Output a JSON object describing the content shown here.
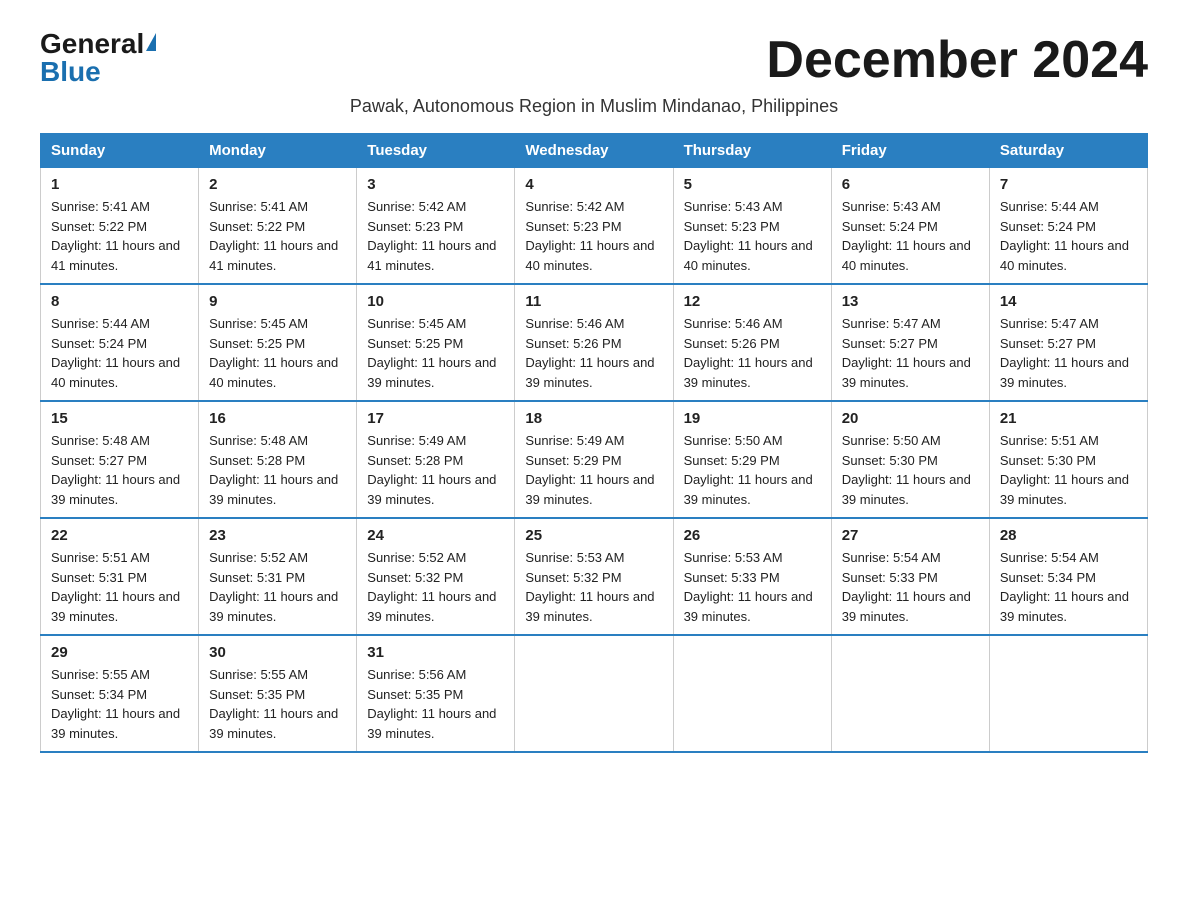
{
  "logo": {
    "general": "General",
    "blue": "Blue"
  },
  "title": "December 2024",
  "subtitle": "Pawak, Autonomous Region in Muslim Mindanao, Philippines",
  "days_of_week": [
    "Sunday",
    "Monday",
    "Tuesday",
    "Wednesday",
    "Thursday",
    "Friday",
    "Saturday"
  ],
  "weeks": [
    [
      {
        "day": "1",
        "sunrise": "5:41 AM",
        "sunset": "5:22 PM",
        "daylight": "11 hours and 41 minutes."
      },
      {
        "day": "2",
        "sunrise": "5:41 AM",
        "sunset": "5:22 PM",
        "daylight": "11 hours and 41 minutes."
      },
      {
        "day": "3",
        "sunrise": "5:42 AM",
        "sunset": "5:23 PM",
        "daylight": "11 hours and 41 minutes."
      },
      {
        "day": "4",
        "sunrise": "5:42 AM",
        "sunset": "5:23 PM",
        "daylight": "11 hours and 40 minutes."
      },
      {
        "day": "5",
        "sunrise": "5:43 AM",
        "sunset": "5:23 PM",
        "daylight": "11 hours and 40 minutes."
      },
      {
        "day": "6",
        "sunrise": "5:43 AM",
        "sunset": "5:24 PM",
        "daylight": "11 hours and 40 minutes."
      },
      {
        "day": "7",
        "sunrise": "5:44 AM",
        "sunset": "5:24 PM",
        "daylight": "11 hours and 40 minutes."
      }
    ],
    [
      {
        "day": "8",
        "sunrise": "5:44 AM",
        "sunset": "5:24 PM",
        "daylight": "11 hours and 40 minutes."
      },
      {
        "day": "9",
        "sunrise": "5:45 AM",
        "sunset": "5:25 PM",
        "daylight": "11 hours and 40 minutes."
      },
      {
        "day": "10",
        "sunrise": "5:45 AM",
        "sunset": "5:25 PM",
        "daylight": "11 hours and 39 minutes."
      },
      {
        "day": "11",
        "sunrise": "5:46 AM",
        "sunset": "5:26 PM",
        "daylight": "11 hours and 39 minutes."
      },
      {
        "day": "12",
        "sunrise": "5:46 AM",
        "sunset": "5:26 PM",
        "daylight": "11 hours and 39 minutes."
      },
      {
        "day": "13",
        "sunrise": "5:47 AM",
        "sunset": "5:27 PM",
        "daylight": "11 hours and 39 minutes."
      },
      {
        "day": "14",
        "sunrise": "5:47 AM",
        "sunset": "5:27 PM",
        "daylight": "11 hours and 39 minutes."
      }
    ],
    [
      {
        "day": "15",
        "sunrise": "5:48 AM",
        "sunset": "5:27 PM",
        "daylight": "11 hours and 39 minutes."
      },
      {
        "day": "16",
        "sunrise": "5:48 AM",
        "sunset": "5:28 PM",
        "daylight": "11 hours and 39 minutes."
      },
      {
        "day": "17",
        "sunrise": "5:49 AM",
        "sunset": "5:28 PM",
        "daylight": "11 hours and 39 minutes."
      },
      {
        "day": "18",
        "sunrise": "5:49 AM",
        "sunset": "5:29 PM",
        "daylight": "11 hours and 39 minutes."
      },
      {
        "day": "19",
        "sunrise": "5:50 AM",
        "sunset": "5:29 PM",
        "daylight": "11 hours and 39 minutes."
      },
      {
        "day": "20",
        "sunrise": "5:50 AM",
        "sunset": "5:30 PM",
        "daylight": "11 hours and 39 minutes."
      },
      {
        "day": "21",
        "sunrise": "5:51 AM",
        "sunset": "5:30 PM",
        "daylight": "11 hours and 39 minutes."
      }
    ],
    [
      {
        "day": "22",
        "sunrise": "5:51 AM",
        "sunset": "5:31 PM",
        "daylight": "11 hours and 39 minutes."
      },
      {
        "day": "23",
        "sunrise": "5:52 AM",
        "sunset": "5:31 PM",
        "daylight": "11 hours and 39 minutes."
      },
      {
        "day": "24",
        "sunrise": "5:52 AM",
        "sunset": "5:32 PM",
        "daylight": "11 hours and 39 minutes."
      },
      {
        "day": "25",
        "sunrise": "5:53 AM",
        "sunset": "5:32 PM",
        "daylight": "11 hours and 39 minutes."
      },
      {
        "day": "26",
        "sunrise": "5:53 AM",
        "sunset": "5:33 PM",
        "daylight": "11 hours and 39 minutes."
      },
      {
        "day": "27",
        "sunrise": "5:54 AM",
        "sunset": "5:33 PM",
        "daylight": "11 hours and 39 minutes."
      },
      {
        "day": "28",
        "sunrise": "5:54 AM",
        "sunset": "5:34 PM",
        "daylight": "11 hours and 39 minutes."
      }
    ],
    [
      {
        "day": "29",
        "sunrise": "5:55 AM",
        "sunset": "5:34 PM",
        "daylight": "11 hours and 39 minutes."
      },
      {
        "day": "30",
        "sunrise": "5:55 AM",
        "sunset": "5:35 PM",
        "daylight": "11 hours and 39 minutes."
      },
      {
        "day": "31",
        "sunrise": "5:56 AM",
        "sunset": "5:35 PM",
        "daylight": "11 hours and 39 minutes."
      },
      null,
      null,
      null,
      null
    ]
  ]
}
